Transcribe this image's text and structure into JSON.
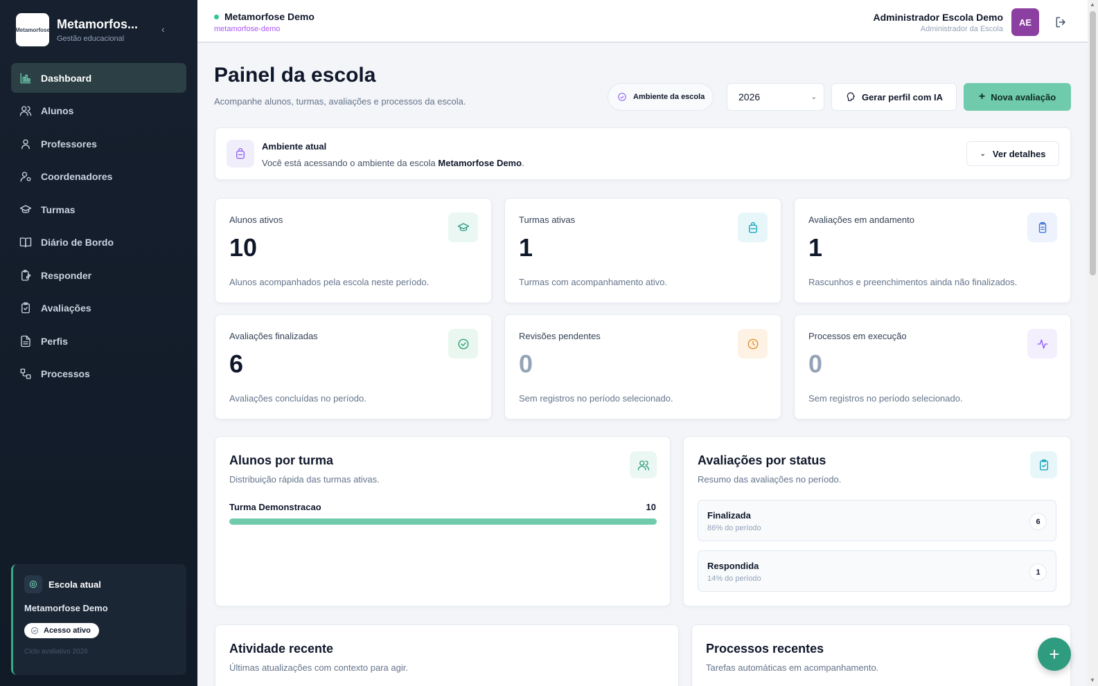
{
  "sidebar": {
    "brand_name": "Metamorfos...",
    "brand_sub": "Gestão educacional",
    "logo_text": "Metamorfose",
    "items": [
      {
        "label": "Dashboard",
        "icon": "chart-bar-icon"
      },
      {
        "label": "Alunos",
        "icon": "users-icon"
      },
      {
        "label": "Professores",
        "icon": "user-icon"
      },
      {
        "label": "Coordenadores",
        "icon": "user-cog-icon"
      },
      {
        "label": "Turmas",
        "icon": "graduation-cap-icon"
      },
      {
        "label": "Diário de Bordo",
        "icon": "book-open-icon"
      },
      {
        "label": "Responder",
        "icon": "clipboard-edit-icon"
      },
      {
        "label": "Avaliações",
        "icon": "clipboard-check-icon"
      },
      {
        "label": "Perfis",
        "icon": "file-text-icon"
      },
      {
        "label": "Processos",
        "icon": "workflow-icon"
      }
    ],
    "school_card": {
      "title": "Escola atual",
      "name": "Metamorfose Demo",
      "access": "Acesso ativo",
      "cycle": "Ciclo avaliativo 2026"
    }
  },
  "topbar": {
    "school": "Metamorfose Demo",
    "slug": "metamorfose-demo",
    "user_name": "Administrador Escola Demo",
    "user_role": "Administrador da Escola",
    "avatar": "AE"
  },
  "header": {
    "title": "Painel da escola",
    "subtitle": "Acompanhe alunos, turmas, avaliações e processos da escola.",
    "env_pill": "Ambiente da escola",
    "year": "2026",
    "ai_button": "Gerar perfil com IA",
    "new_button": "Nova avaliação"
  },
  "env_card": {
    "title": "Ambiente atual",
    "desc_prefix": "Você está acessando o ambiente da escola",
    "school": "Metamorfose Demo",
    "desc_suffix": ".",
    "details_button": "Ver detalhes"
  },
  "stats": [
    {
      "label": "Alunos ativos",
      "value": "10",
      "desc": "Alunos acompanhados pela escola neste período.",
      "icon": "graduation-cap-icon",
      "color": "#2f9c7f",
      "bg": "#eaf7f3"
    },
    {
      "label": "Turmas ativas",
      "value": "1",
      "desc": "Turmas com acompanhamento ativo.",
      "icon": "backpack-icon",
      "color": "#0e9fb5",
      "bg": "#e6f6f9"
    },
    {
      "label": "Avaliações em andamento",
      "value": "1",
      "desc": "Rascunhos e preenchimentos ainda não finalizados.",
      "icon": "clipboard-list-icon",
      "color": "#3b6fd8",
      "bg": "#edf2fc"
    },
    {
      "label": "Avaliações finalizadas",
      "value": "6",
      "desc": "Avaliações concluídas no período.",
      "icon": "check-circle-icon",
      "color": "#22a06b",
      "bg": "#e9f7f0"
    },
    {
      "label": "Revisões pendentes",
      "value": "0",
      "desc": "Sem registros no período selecionado.",
      "icon": "clock-icon",
      "color": "#e58a1f",
      "bg": "#fdf2e4"
    },
    {
      "label": "Processos em execução",
      "value": "0",
      "desc": "Sem registros no período selecionado.",
      "icon": "activity-icon",
      "color": "#8b5cf6",
      "bg": "#f3effd"
    }
  ],
  "alunos_por_turma": {
    "title": "Alunos por turma",
    "subtitle": "Distribuição rápida das turmas ativas.",
    "rows": [
      {
        "label": "Turma Demonstracao",
        "value": "10",
        "fraction": 1.0
      }
    ]
  },
  "avaliacoes_por_status": {
    "title": "Avaliações por status",
    "subtitle": "Resumo das avaliações no período.",
    "items": [
      {
        "name": "Finalizada",
        "pct": "86% do período",
        "count": "6"
      },
      {
        "name": "Respondida",
        "pct": "14% do período",
        "count": "1"
      }
    ]
  },
  "atividade": {
    "title": "Atividade recente",
    "subtitle": "Últimas atualizações com contexto para agir."
  },
  "processos": {
    "title": "Processos recentes",
    "subtitle": "Tarefas automáticas em acompanhamento."
  },
  "fab_label": "+"
}
